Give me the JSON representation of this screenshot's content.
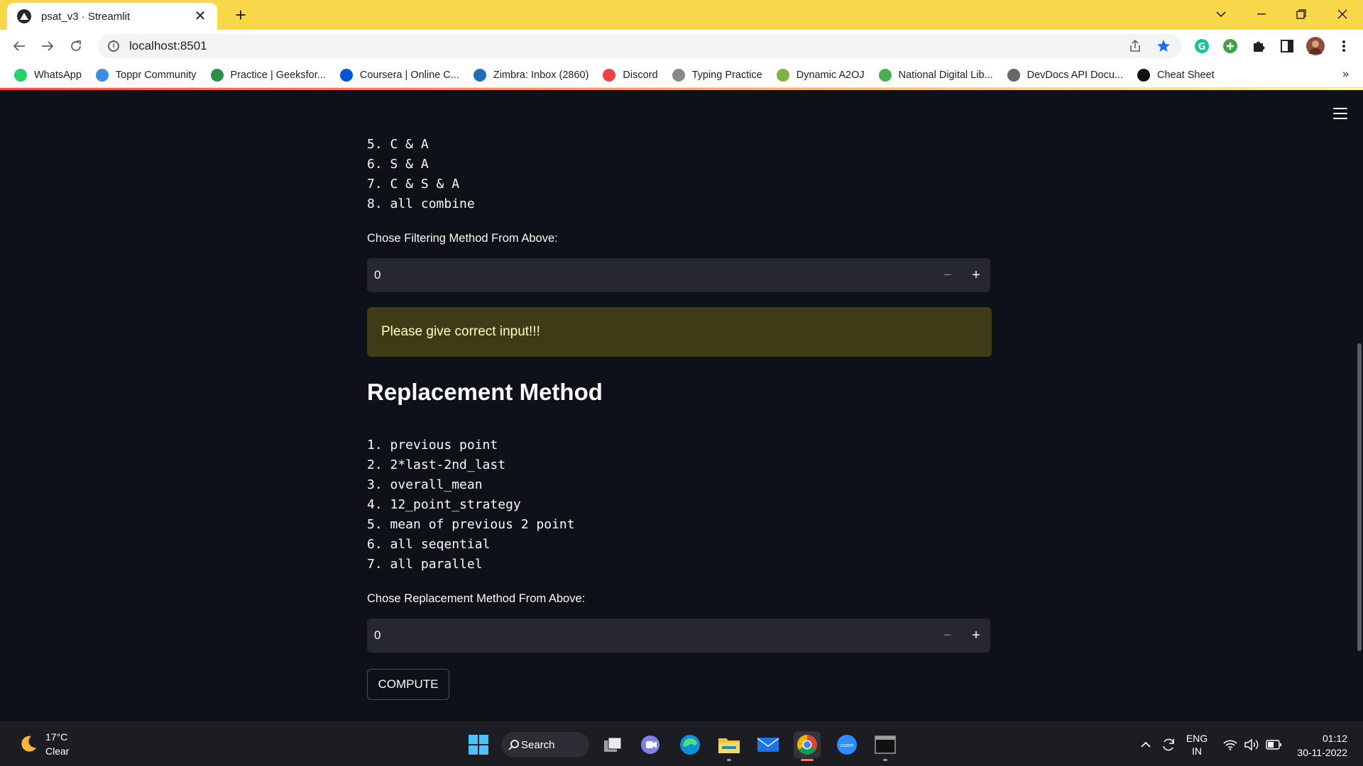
{
  "browser": {
    "tab_title": "psat_v3 · Streamlit",
    "url": "localhost:8501",
    "bookmarks": [
      {
        "label": "WhatsApp",
        "icon": "whatsapp-icon",
        "color": "#25d366"
      },
      {
        "label": "Toppr Community",
        "icon": "toppr-icon",
        "color": "#3a8ee6"
      },
      {
        "label": "Practice | Geeksfor...",
        "icon": "geeksforgeeks-icon",
        "color": "#2f8d46"
      },
      {
        "label": "Coursera | Online C...",
        "icon": "coursera-icon",
        "color": "#0056d2"
      },
      {
        "label": "Zimbra: Inbox (2860)",
        "icon": "zimbra-icon",
        "color": "#1d6fb8"
      },
      {
        "label": "Discord",
        "icon": "discord-icon",
        "color": "#ed4245"
      },
      {
        "label": "Typing Practice",
        "icon": "typing-icon",
        "color": "#888888"
      },
      {
        "label": "Dynamic A2OJ",
        "icon": "a2oj-icon",
        "color": "#7cb342"
      },
      {
        "label": "National Digital Lib...",
        "icon": "ndl-icon",
        "color": "#4caf50"
      },
      {
        "label": "DevDocs API Docu...",
        "icon": "devdocs-icon",
        "color": "#666666"
      },
      {
        "label": "Cheat Sheet",
        "icon": "cheatsheet-icon",
        "color": "#111111"
      }
    ],
    "more_bookmarks": "»"
  },
  "app": {
    "filter_list": "5. C & A\n6. S & A\n7. C & S & A\n8. all combine",
    "filter_label": "Chose Filtering Method From Above:",
    "filter_value": "0",
    "warning": "Please give correct input!!!",
    "replacement_heading": "Replacement Method",
    "replacement_list": "1. previous point\n2. 2*last-2nd_last\n3. overall_mean\n4. 12_point_strategy\n5. mean of previous 2 point\n6. all seqential\n7. all parallel",
    "replacement_label": "Chose Replacement Method From Above:",
    "replacement_value": "0",
    "minus": "−",
    "plus": "+",
    "compute_label": "COMPUTE"
  },
  "taskbar": {
    "temperature": "17°C",
    "weather": "Clear",
    "search_label": "Search",
    "lang_top": "ENG",
    "lang_bottom": "IN",
    "time": "01:12",
    "date": "30-11-2022"
  }
}
